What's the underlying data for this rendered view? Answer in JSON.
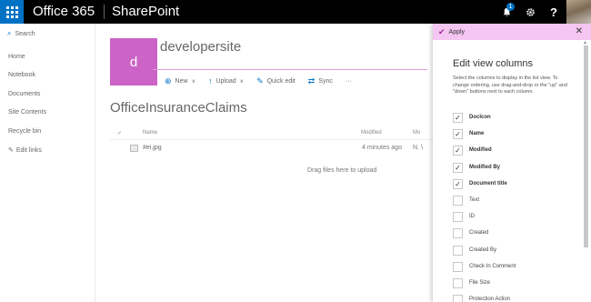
{
  "suite": {
    "brand": "Office 365",
    "app_name": "SharePoint",
    "notification_count": "1",
    "help_label": "?"
  },
  "nav": {
    "search_label": "Search",
    "items": [
      {
        "label": "Home"
      },
      {
        "label": "Notebook"
      },
      {
        "label": "Documents"
      },
      {
        "label": "Site Contents"
      },
      {
        "label": "Recycle bin"
      }
    ],
    "edit_links_label": "Edit links"
  },
  "site": {
    "logo_letter": "d",
    "title": "developersite"
  },
  "commands": {
    "new_label": "New",
    "upload_label": "Upload",
    "quick_edit_label": "Quick edit",
    "sync_label": "Sync",
    "more_label": "···"
  },
  "list": {
    "title": "OfficeInsuranceClaims",
    "columns": {
      "check": "✓",
      "name": "Name",
      "modified": "Modified",
      "modified_by": "Mo"
    },
    "rows": [
      {
        "name": "#ei.jpg",
        "modified": "4 minutes ago",
        "modified_by": "N. \\"
      }
    ],
    "drop_hint": "Drag files here to upload"
  },
  "panel": {
    "apply_label": "Apply",
    "close_label": "✕",
    "title": "Edit view columns",
    "description": "Select the columns to display in the list view. To change ordering, use drag-and-drop or the \"up\" and \"down\" buttons next to each column.",
    "columns": [
      {
        "label": "DocIcon",
        "checked": true,
        "mark": "✓"
      },
      {
        "label": "Name",
        "checked": true,
        "mark": "✓"
      },
      {
        "label": "Modified",
        "checked": true,
        "mark": "✓"
      },
      {
        "label": "Modified By",
        "checked": true,
        "mark": "✓"
      },
      {
        "label": "Document title",
        "checked": true,
        "mark": "✓"
      },
      {
        "label": "Text",
        "checked": false,
        "mark": ""
      },
      {
        "label": "ID",
        "checked": false,
        "mark": ""
      },
      {
        "label": "Created",
        "checked": false,
        "mark": ""
      },
      {
        "label": "Created By",
        "checked": false,
        "mark": ""
      },
      {
        "label": "Check In Comment",
        "checked": false,
        "mark": ""
      },
      {
        "label": "File Size",
        "checked": false,
        "mark": ""
      },
      {
        "label": "Protection Action",
        "checked": false,
        "mark": ""
      }
    ]
  },
  "colors": {
    "suite_bar": "#000000",
    "waffle_blue": "#0072c6",
    "site_logo": "#cc63c6",
    "apply_bar": "#f5c6f1",
    "accent_line": "#d99ad6"
  }
}
